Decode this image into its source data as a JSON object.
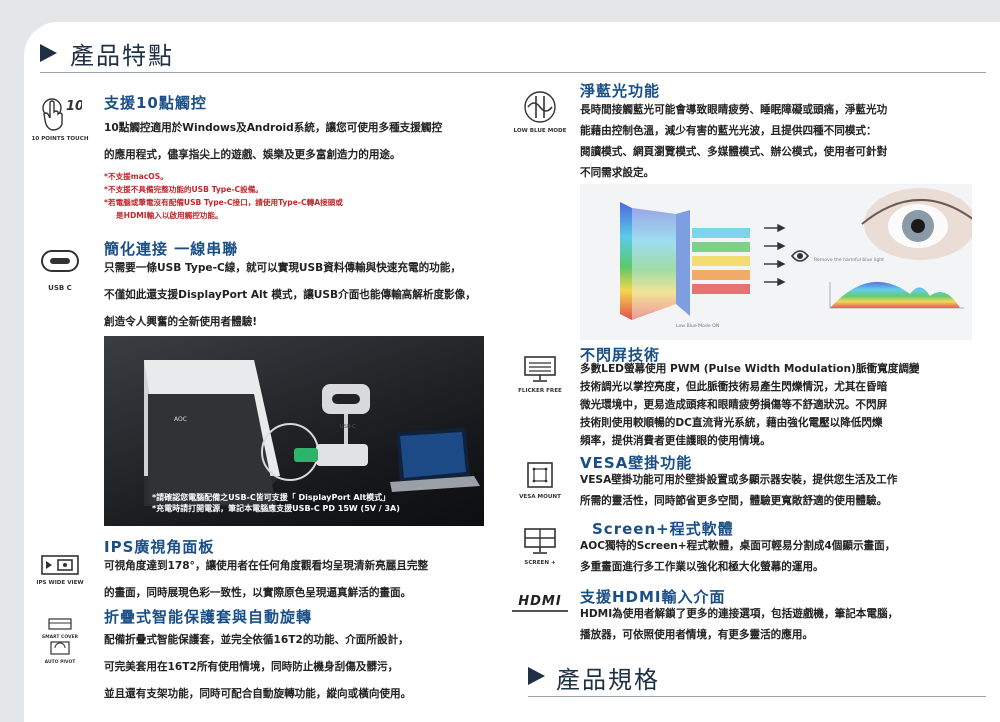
{
  "sections": {
    "features_heading": "產品特點",
    "specs_heading": "產品規格"
  },
  "features": {
    "touch": {
      "title": "支援10點觸控",
      "icon_label": "10 POINTS TOUCH",
      "icon_number": "10",
      "lines": [
        "10點觸控適用於Windows及Android系統，讓您可使用多種支援觸控",
        "的應用程式，儘享指尖上的遊戲、娛樂及更多富創造力的用途。"
      ],
      "notes": [
        "*不支援macOS。",
        "*不支援不具備完整功能的USB Type-C設備。",
        "*若電腦或筆電沒有配備USB Type-C接口，請使用Type-C轉A接頭或",
        "是HDMI輸入以啟用觸控功能。"
      ]
    },
    "usbc": {
      "title": "簡化連接 一線串聯",
      "icon_label": "USB C",
      "lines": [
        "只需要一條USB Type-C線，就可以實現USB資料傳輸與快速充電的功能，",
        "不僅如此還支援DisplayPort Alt 模式，讓USB介面也能傳輸高解析度影像，",
        "創造令人興奮的全新使用者體驗!"
      ],
      "image_notes": [
        "*請確認您電腦配備之USB-C皆可支援「 DisplayPort Alt模式」",
        "*充電時請打開電源，筆記本電腦應支援USB-C PD 15W (5V / 3A)"
      ],
      "image_brand": "AOC",
      "image_port": "USB-C"
    },
    "ips": {
      "title": "IPS廣視角面板",
      "icon_label": "IPS WIDE VIEW",
      "lines": [
        "可視角度達到178°，讓使用者在任何角度觀看均呈現清新亮麗且完整",
        "的畫面，同時展現色彩一致性，以實際原色呈現逼真鮮活的畫面。"
      ]
    },
    "smartcover": {
      "title": "折疊式智能保護套與自動旋轉",
      "icon_label_1": "SMART COVER",
      "icon_label_2": "AUTO PIVOT",
      "lines": [
        "配備折疊式智能保護套，並完全依循16T2的功能、介面所設計，",
        "可完美套用在16T2所有使用情境，同時防止機身刮傷及髒污，",
        "並且還有支架功能，同時可配合自動旋轉功能，縱向或橫向使用。"
      ]
    },
    "lowblue": {
      "title": "淨藍光功能",
      "icon_label": "LOW BLUE MODE",
      "lines": [
        "長時間接觸藍光可能會導致眼睛疲勞、睡眠障礙或頭痛，淨藍光功",
        "能藉由控制色溫，減少有害的藍光光波，且提供四種不同模式：",
        "閱讀模式、網頁瀏覽模式、多媒體模式、辦公模式，使用者可針對",
        "不同需求設定。"
      ],
      "image_caption_1": "Remove the harmful blue light",
      "image_caption_2": "Low Blue Mode ON"
    },
    "flicker": {
      "title": "不閃屏技術",
      "icon_label": "FLICKER FREE",
      "lines": [
        "多數LED螢幕使用 PWM (Pulse Width Modulation)脈衝寬度調變",
        "技術調光以掌控亮度，但此脈衝技術易產生閃爍情況，尤其在昏暗",
        "微光環境中，更易造成頭疼和眼睛疲勞損傷等不舒適狀況。不閃屏",
        "技術則使用較順暢的DC直流背光系統，藉由強化電壓以降低閃爍",
        "頻率，提供消費者更佳護眼的使用情境。"
      ]
    },
    "vesa": {
      "title": "VESA壁掛功能",
      "icon_label": "VESA MOUNT",
      "lines": [
        "VESA壁掛功能可用於壁掛設置或多顯示器安裝，提供您生活及工作",
        "所需的靈活性，同時節省更多空間，體驗更寬敞舒適的使用體驗。"
      ]
    },
    "screenplus": {
      "title": "Screen+程式軟體",
      "icon_label": "SCREEN +",
      "lines": [
        "AOC獨特的Screen+程式軟體，桌面可輕易分割成4個顯示畫面，",
        "多重畫面進行多工作業以強化和極大化螢幕的運用。"
      ]
    },
    "hdmi": {
      "title": "支援HDMI輸入介面",
      "icon_label": "HDMI",
      "lines": [
        "HDMI為使用者解鎖了更多的連接選項，包括遊戲機，筆記本電腦，",
        "播放器，可依照使用者情境，有更多靈活的應用。"
      ]
    }
  },
  "colors": {
    "title_blue": "#1a4f86",
    "note_red": "#c0282d",
    "heading_navy": "#1f2f44"
  }
}
